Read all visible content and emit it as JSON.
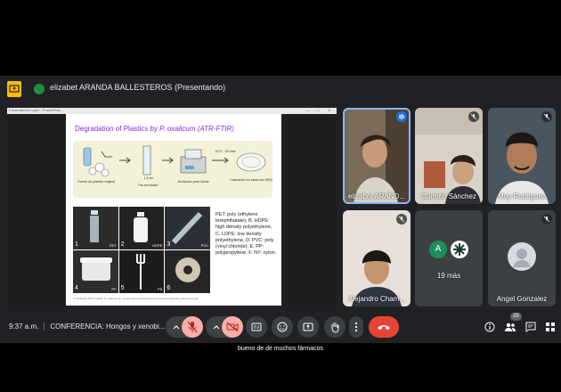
{
  "header": {
    "presenter": "elizabet ARANDA BALLESTEROS (Presentando)"
  },
  "shared_window": {
    "title": "Presentación1.pptx - PowerPoint",
    "controls": [
      "—",
      "□",
      "✕"
    ]
  },
  "slide": {
    "title_plain": "Degradation of Plastics by ",
    "title_italic": "P. oxalicum (ATR-FTIR)",
    "process_labels": {
      "step1": "Fuente de plástico original",
      "step2": "Tira recortada",
      "step2_dim": "1,5 cm",
      "step3": "Anotación peso inicial",
      "step4": "Colocación en placa con MEA",
      "arrow_note": "30°C · 30 días"
    },
    "photo_tags": [
      "PET",
      "HDPE",
      "PVC",
      "LDPE",
      "PP",
      "PS"
    ],
    "recycle_codes": [
      "1",
      "2",
      "3",
      "4",
      "5",
      "6"
    ],
    "body": "PET: poly (ethylene terephthalate), B. HDPE: high density polyethylene, C. LDPE: low density polyethylene, D. PVC: poly (vinyl chloride), E. PP: polypropylene, F. NY: nylon.",
    "footer": "Contribution fabric article: P. oxalicum sp. (www.mdpi.com/journal/microorganisms/special_issues/ecology)"
  },
  "participants": [
    {
      "name": "elizabet ARAND...",
      "speaking": true
    },
    {
      "name": "Carmen Sánchez",
      "muted": true
    },
    {
      "name": "Moy Rodriguez",
      "muted": true
    },
    {
      "name": "Alejandro Cham...",
      "muted": true
    },
    {
      "name": "19 más",
      "avatar_letter": "A"
    },
    {
      "name": "Angel Gonzalez",
      "muted": true
    }
  ],
  "bottom_bar": {
    "time": "9:37 a.m.",
    "meeting": "CONFERENCIA: Hongos y xenobi...",
    "people_count": "25"
  },
  "caption": "bueno de de muchos fármacos",
  "colors": {
    "accent": "#8ab4f8",
    "end_call": "#ea4335",
    "present": "#fbbc04"
  }
}
